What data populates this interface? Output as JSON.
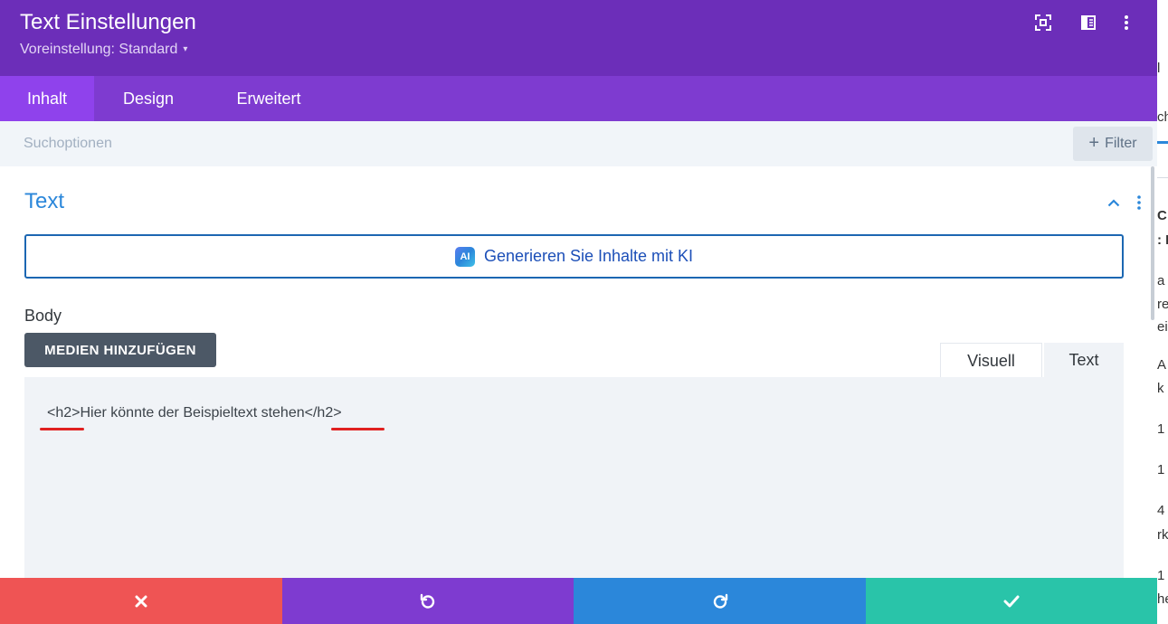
{
  "modal": {
    "title": "Text Einstellungen",
    "preset_label": "Voreinstellung: Standard",
    "preset_caret": "▾",
    "header_icons": [
      "fullscreen-icon",
      "sidebar-layout-icon",
      "more-vertical-icon"
    ]
  },
  "tabs": [
    {
      "label": "Inhalt",
      "active": true
    },
    {
      "label": "Design",
      "active": false
    },
    {
      "label": "Erweitert",
      "active": false
    }
  ],
  "search": {
    "placeholder": "Suchoptionen",
    "filter_label": "Filter",
    "filter_icon": "+"
  },
  "section": {
    "title": "Text",
    "ai_button_label": "Generieren Sie Inhalte mit KI",
    "ai_badge": "AI",
    "body_label": "Body",
    "media_button_label": "MEDIEN HINZUFÜGEN",
    "editor_tabs": [
      {
        "label": "Visuell",
        "active": false
      },
      {
        "label": "Text",
        "active": true
      }
    ],
    "editor_content": "<h2>Hier könnte der Beispieltext stehen</h2>"
  },
  "footer": {
    "buttons": [
      "close-icon",
      "undo-icon",
      "redo-icon",
      "check-icon"
    ]
  },
  "colors": {
    "header": "#6c2eb9",
    "tabs": "#7e3bd0",
    "active_tab": "#8f42ec",
    "accent_blue": "#2b87da",
    "cancel": "#ef5454",
    "undo": "#7e3bd0",
    "redo": "#2b87da",
    "save": "#29c4a9",
    "annotation": "#e02020"
  },
  "background_fragments": [
    "l",
    "ch",
    "C",
    ": K",
    "a",
    "re",
    "ei",
    "A",
    "k",
    "1",
    "1",
    "4",
    "rk",
    "1",
    "he"
  ]
}
